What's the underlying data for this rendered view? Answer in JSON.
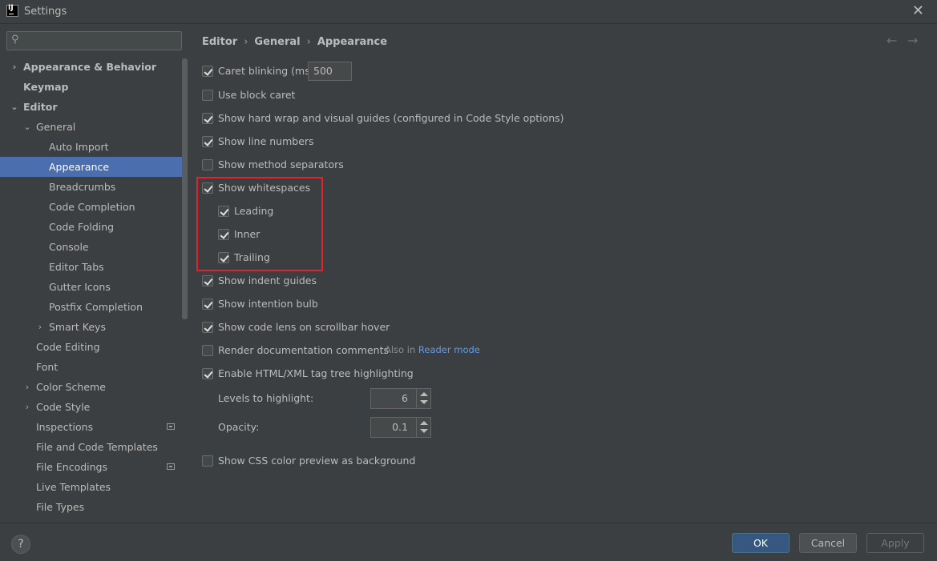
{
  "window": {
    "title": "Settings"
  },
  "search": {
    "placeholder": "",
    "icon": "search-icon"
  },
  "sidebar": {
    "items": [
      {
        "label": "Appearance & Behavior",
        "arrow": "›"
      },
      {
        "label": "Keymap"
      },
      {
        "label": "Editor",
        "arrow": "⌄"
      },
      {
        "label": "General",
        "arrow": "⌄"
      },
      {
        "label": "Auto Import"
      },
      {
        "label": "Appearance",
        "selected": true
      },
      {
        "label": "Breadcrumbs"
      },
      {
        "label": "Code Completion"
      },
      {
        "label": "Code Folding"
      },
      {
        "label": "Console"
      },
      {
        "label": "Editor Tabs"
      },
      {
        "label": "Gutter Icons"
      },
      {
        "label": "Postfix Completion"
      },
      {
        "label": "Smart Keys",
        "arrow": "›"
      },
      {
        "label": "Code Editing"
      },
      {
        "label": "Font"
      },
      {
        "label": "Color Scheme",
        "arrow": "›"
      },
      {
        "label": "Code Style",
        "arrow": "›"
      },
      {
        "label": "Inspections",
        "badge": true
      },
      {
        "label": "File and Code Templates"
      },
      {
        "label": "File Encodings",
        "badge": true
      },
      {
        "label": "Live Templates"
      },
      {
        "label": "File Types"
      }
    ]
  },
  "breadcrumb": {
    "items": [
      "Editor",
      "General",
      "Appearance"
    ],
    "separator": "›"
  },
  "nav": {
    "back": "←",
    "forward": "→"
  },
  "options": {
    "caret_blinking": {
      "label": "Caret blinking (ms):",
      "checked": true,
      "value": "500"
    },
    "block_caret": {
      "label": "Use block caret",
      "checked": false
    },
    "hard_wrap": {
      "label": "Show hard wrap and visual guides (configured in Code Style options)",
      "checked": true
    },
    "line_numbers": {
      "label": "Show line numbers",
      "checked": true
    },
    "method_separators": {
      "label": "Show method separators",
      "checked": false
    },
    "whitespaces": {
      "label": "Show whitespaces",
      "checked": true
    },
    "leading": {
      "label": "Leading",
      "checked": true
    },
    "inner": {
      "label": "Inner",
      "checked": true
    },
    "trailing": {
      "label": "Trailing",
      "checked": true
    },
    "indent_guides": {
      "label": "Show indent guides",
      "checked": true
    },
    "intention_bulb": {
      "label": "Show intention bulb",
      "checked": true
    },
    "code_lens": {
      "label": "Show code lens on scrollbar hover",
      "checked": true
    },
    "render_docs": {
      "label": "Render documentation comments",
      "checked": false,
      "hint_prefix": "Also in",
      "hint_link": "Reader mode"
    },
    "tag_tree": {
      "label": "Enable HTML/XML tag tree highlighting",
      "checked": true
    },
    "levels": {
      "label": "Levels to highlight:",
      "value": "6"
    },
    "opacity": {
      "label": "Opacity:",
      "value": "0.1"
    },
    "css_preview": {
      "label": "Show CSS color preview as background",
      "checked": false
    }
  },
  "footer": {
    "help": "?",
    "ok": "OK",
    "cancel": "Cancel",
    "apply": "Apply"
  },
  "colors": {
    "selection": "#4b6eaf",
    "accent": "#365880",
    "highlight_box": "#e0242c",
    "link": "#589df6"
  }
}
